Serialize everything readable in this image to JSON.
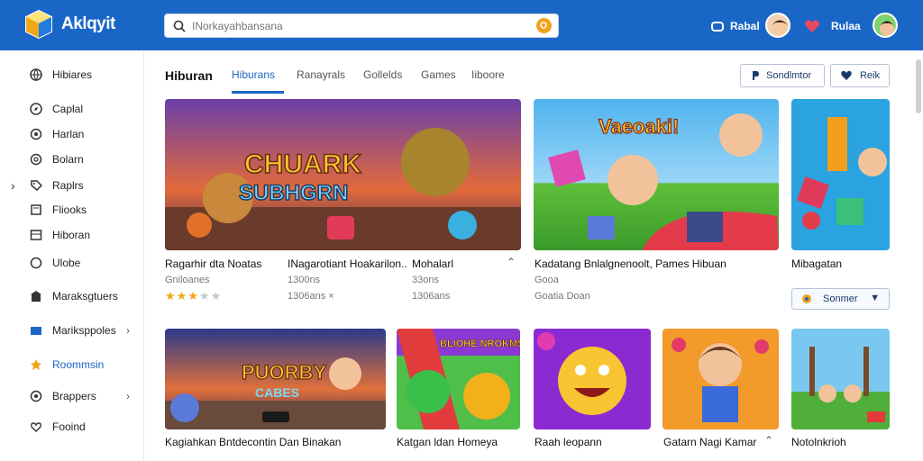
{
  "app": {
    "name": "Aklqyit"
  },
  "search": {
    "placeholder": "INorkayahbansana"
  },
  "top": {
    "action1_label": "Rabal",
    "action2_label": "Rulaa"
  },
  "sidebar": {
    "items": [
      {
        "label": "Hibiares",
        "icon": "globe-icon"
      },
      {
        "label": "Caplal",
        "icon": "compass-icon"
      },
      {
        "label": "Harlan",
        "icon": "circle-icon"
      },
      {
        "label": "Bolarn",
        "icon": "circle-icon"
      },
      {
        "label": "Raplrs",
        "icon": "tag-icon"
      },
      {
        "label": "Fliooks",
        "icon": "book-icon"
      },
      {
        "label": "Hiboran",
        "icon": "grid-icon"
      },
      {
        "label": "Ulobe",
        "icon": "circle-icon"
      },
      {
        "label": "Maraksgtuers",
        "icon": "store-icon"
      },
      {
        "label": "Mariksppoles",
        "icon": "folder-icon"
      },
      {
        "label": "Roommsin",
        "icon": "star-icon"
      },
      {
        "label": "Brappers",
        "icon": "shield-icon"
      },
      {
        "label": "Fooind",
        "icon": "heart-icon"
      }
    ]
  },
  "tabs": {
    "title": "Hiburan",
    "items": [
      "Hiburans",
      "Ranayrals",
      "Gollelds",
      "Games",
      "Iiboore"
    ]
  },
  "header_buttons": {
    "primary": "Sondlmtor",
    "secondary": "Reik"
  },
  "cards_row1": [
    {
      "title": "Ragarhir dta Noatas",
      "sub1": "Gniloanes",
      "rating": 3,
      "thumb_text_1": "CHUARK",
      "thumb_text_2": "SUBHGRN"
    },
    {
      "title": "INagarotiant Hoakarilon..",
      "sub1": "1300ns",
      "sub2": "1306ans ×"
    },
    {
      "title": "Mohalarl",
      "sub1": "33ons",
      "sub2": "1306ans"
    },
    {
      "title": "Kadatang Bnlalgnenoolt, Pames Hibuan",
      "sub1": "Gooa",
      "sub2": "Goatia Doan",
      "thumb_text_1": "Vaeoaki!"
    },
    {
      "title": "Mibagatan",
      "select_label": "Sonmer"
    }
  ],
  "cards_row2": [
    {
      "title": "Kagiahkan Bntdecontin Dan Binakan",
      "thumb_text_1": "PUORBY",
      "thumb_text_2": "CABES"
    },
    {
      "title": "Katgan ldan Homeya",
      "thumb_text_1": "BLIOHE NROKMS"
    },
    {
      "title": "Raah leopann"
    },
    {
      "title": "Gatarn Nagi Kamar"
    },
    {
      "title": "Notolnkrioh"
    }
  ],
  "colors": {
    "topbar": "#1a66c6",
    "accent": "#1a66c6",
    "star": "#f0a81a"
  }
}
